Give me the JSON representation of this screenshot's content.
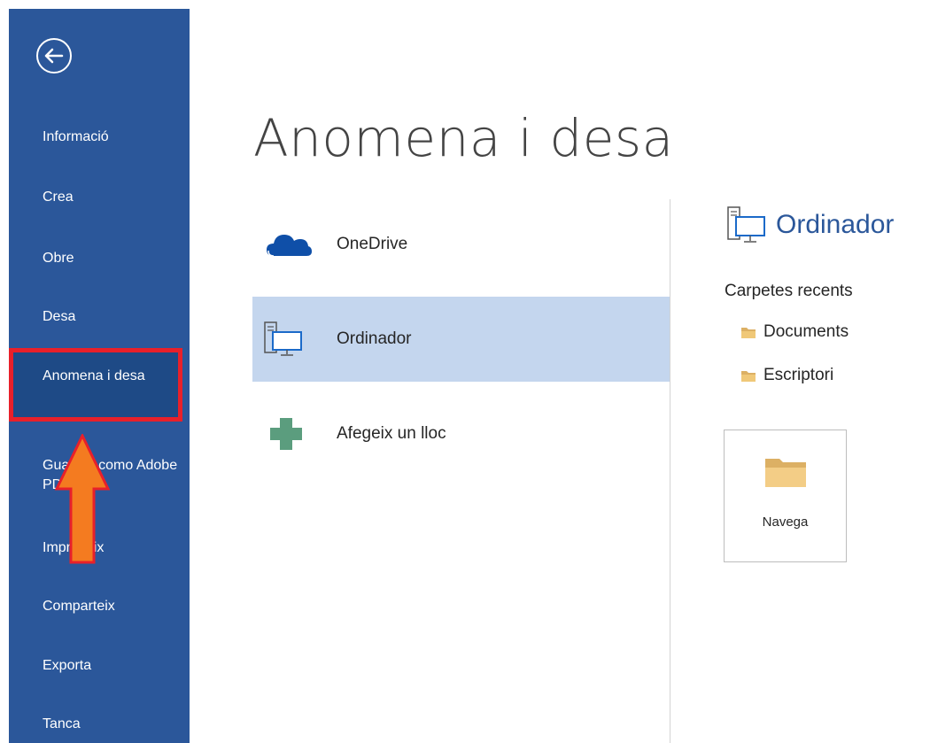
{
  "sidebar": {
    "items": [
      {
        "label": "Informació"
      },
      {
        "label": "Crea"
      },
      {
        "label": "Obre"
      },
      {
        "label": "Desa"
      },
      {
        "label": "Anomena i desa"
      },
      {
        "label": "Guardar como Adobe PDF"
      },
      {
        "label": "Imprimeix"
      },
      {
        "label": "Comparteix"
      },
      {
        "label": "Exporta"
      },
      {
        "label": "Tanca"
      }
    ],
    "selected_index": 4
  },
  "main": {
    "title": "Anomena i desa",
    "locations": [
      {
        "label": "OneDrive",
        "icon": "onedrive-cloud-icon"
      },
      {
        "label": "Ordinador",
        "icon": "computer-icon",
        "selected": true
      },
      {
        "label": "Afegeix un lloc",
        "icon": "plus-icon"
      }
    ]
  },
  "right_panel": {
    "title": "Ordinador",
    "recent_title": "Carpetes recents",
    "folders": [
      {
        "label": "Documents"
      },
      {
        "label": "Escriptori"
      }
    ],
    "browse_label": "Navega"
  },
  "colors": {
    "sidebar_bg": "#2b579a",
    "selected_location": "#c4d6ee",
    "highlight_border": "#e8202a",
    "arrow_fill": "#f47b20"
  }
}
